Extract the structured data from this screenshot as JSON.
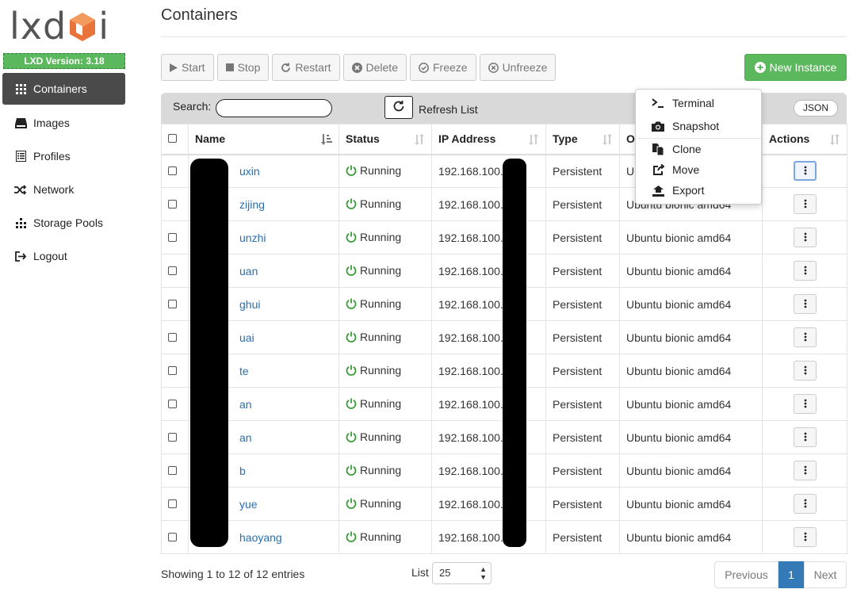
{
  "app": {
    "logo_text": "lxd",
    "logo_suffix": "i",
    "version": "LXD Version: 3.18"
  },
  "nav": [
    {
      "label": "Containers",
      "icon": "grid-icon",
      "active": true
    },
    {
      "label": "Images",
      "icon": "hdd-icon"
    },
    {
      "label": "Profiles",
      "icon": "list-icon"
    },
    {
      "label": "Network",
      "icon": "shuffle-icon"
    },
    {
      "label": "Storage Pools",
      "icon": "storage-icon"
    },
    {
      "label": "Logout",
      "icon": "logout-icon"
    }
  ],
  "page": {
    "title": "Containers"
  },
  "toolbar": {
    "start": "Start",
    "stop": "Stop",
    "restart": "Restart",
    "delete": "Delete",
    "freeze": "Freeze",
    "unfreeze": "Unfreeze",
    "new_instance": "New Instance"
  },
  "search": {
    "label": "Search:",
    "value": "",
    "refresh": "Refresh List",
    "json": "JSON"
  },
  "table": {
    "headers": {
      "name": "Name",
      "status": "Status",
      "ip": "IP Address",
      "type": "Type",
      "os": "OS",
      "actions": "Actions"
    },
    "rows": [
      {
        "name": "uxin",
        "status": "Running",
        "ip": "192.168.100.",
        "type": "Persistent",
        "os": "Ub"
      },
      {
        "name": "zijing",
        "status": "Running",
        "ip": "192.168.100.",
        "type": "Persistent",
        "os": "Ubuntu bionic amd64"
      },
      {
        "name": "unzhi",
        "status": "Running",
        "ip": "192.168.100.",
        "type": "Persistent",
        "os": "Ubuntu bionic amd64"
      },
      {
        "name": "uan",
        "status": "Running",
        "ip": "192.168.100.",
        "type": "Persistent",
        "os": "Ubuntu bionic amd64"
      },
      {
        "name": "ghui",
        "status": "Running",
        "ip": "192.168.100.",
        "type": "Persistent",
        "os": "Ubuntu bionic amd64"
      },
      {
        "name": "uai",
        "status": "Running",
        "ip": "192.168.100.",
        "type": "Persistent",
        "os": "Ubuntu bionic amd64"
      },
      {
        "name": "te",
        "status": "Running",
        "ip": "192.168.100.",
        "type": "Persistent",
        "os": "Ubuntu bionic amd64"
      },
      {
        "name": "an",
        "status": "Running",
        "ip": "192.168.100.",
        "type": "Persistent",
        "os": "Ubuntu bionic amd64"
      },
      {
        "name": "an",
        "status": "Running",
        "ip": "192.168.100.",
        "type": "Persistent",
        "os": "Ubuntu bionic amd64"
      },
      {
        "name": "b",
        "status": "Running",
        "ip": "192.168.100.",
        "type": "Persistent",
        "os": "Ubuntu bionic amd64"
      },
      {
        "name": "yue",
        "status": "Running",
        "ip": "192.168.100.",
        "type": "Persistent",
        "os": "Ubuntu bionic amd64"
      },
      {
        "name": "haoyang",
        "status": "Running",
        "ip": "192.168.100.",
        "type": "Persistent",
        "os": "Ubuntu bionic amd64"
      }
    ]
  },
  "actions_menu": {
    "terminal": "Terminal",
    "snapshot": "Snapshot",
    "clone": "Clone",
    "move": "Move",
    "export": "Export"
  },
  "footer": {
    "showing": "Showing 1 to 12 of 12 entries",
    "list_label": "List",
    "page_size": "25",
    "previous": "Previous",
    "current_page": "1",
    "next": "Next"
  },
  "colors": {
    "accent_green": "#5cb85c",
    "link_blue": "#2a6fb0",
    "running_green": "#3a9a3a",
    "sidebar_active": "#4a4a4a",
    "pager_blue": "#337ab7"
  }
}
